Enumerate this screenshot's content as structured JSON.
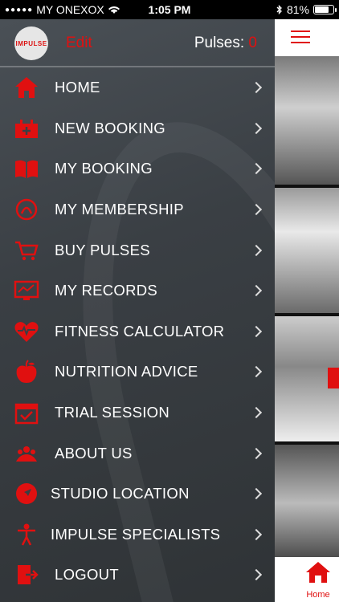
{
  "status_bar": {
    "carrier": "MY ONEXOX",
    "time": "1:05 PM",
    "battery": "81%",
    "battery_level": 0.81
  },
  "drawer": {
    "logo_text": "IMPULSE",
    "edit_label": "Edit",
    "pulses_label": "Pulses:",
    "pulses_count": "0",
    "menu": [
      {
        "label": "HOME",
        "icon": "home-icon"
      },
      {
        "label": "NEW BOOKING",
        "icon": "calendar-add-icon"
      },
      {
        "label": "MY BOOKING",
        "icon": "book-icon"
      },
      {
        "label": "MY MEMBERSHIP",
        "icon": "membership-icon"
      },
      {
        "label": "BUY PULSES",
        "icon": "cart-icon"
      },
      {
        "label": "MY RECORDS",
        "icon": "monitor-chart-icon"
      },
      {
        "label": "FITNESS CALCULATOR",
        "icon": "heart-pulse-icon"
      },
      {
        "label": "NUTRITION ADVICE",
        "icon": "apple-icon"
      },
      {
        "label": "TRIAL SESSION",
        "icon": "calendar-check-icon"
      },
      {
        "label": "ABOUT US",
        "icon": "team-icon"
      },
      {
        "label": "STUDIO LOCATION",
        "icon": "location-icon"
      },
      {
        "label": "IMPULSE SPECIALISTS",
        "icon": "person-icon"
      },
      {
        "label": "LOGOUT",
        "icon": "logout-icon"
      }
    ]
  },
  "bottom_nav": {
    "home_label": "Home"
  },
  "colors": {
    "accent": "#e01010",
    "drawer_bg": "#3a3f44"
  }
}
